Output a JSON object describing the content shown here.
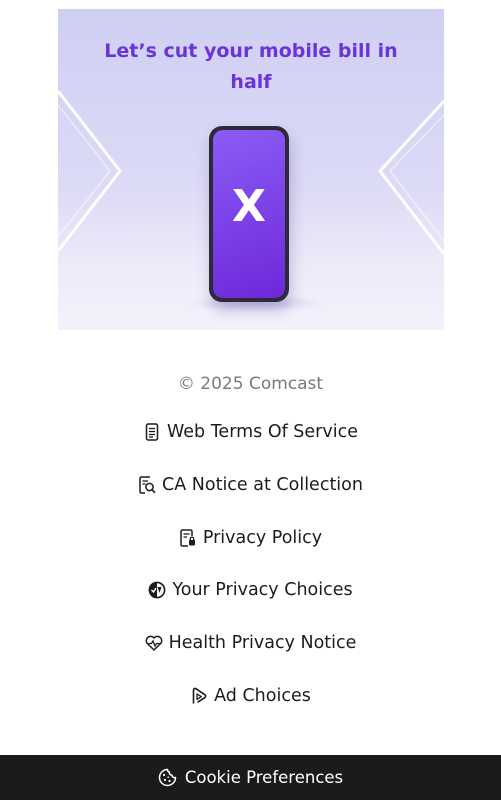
{
  "ad": {
    "headline_line1": "Let’s cut your mobile bill in",
    "headline_line2": "half",
    "phone_logo": "X"
  },
  "footer": {
    "copyright": "© 2025 Comcast",
    "links": [
      {
        "label": "Web Terms Of Service",
        "icon": "document-icon"
      },
      {
        "label": "CA Notice at Collection",
        "icon": "document-search-icon"
      },
      {
        "label": "Privacy Policy",
        "icon": "document-lock-icon"
      },
      {
        "label": "Your Privacy Choices",
        "icon": "privacy-choices-icon"
      },
      {
        "label": "Health Privacy Notice",
        "icon": "heart-pulse-icon"
      },
      {
        "label": "Ad Choices",
        "icon": "ad-choices-icon"
      }
    ]
  },
  "cookie_bar": {
    "label": "Cookie Preferences",
    "icon": "cookie-icon"
  },
  "colors": {
    "headline": "#6a34d6",
    "phone_screen": "#7c3aed",
    "cookie_bar_bg": "#1b1b1d"
  }
}
